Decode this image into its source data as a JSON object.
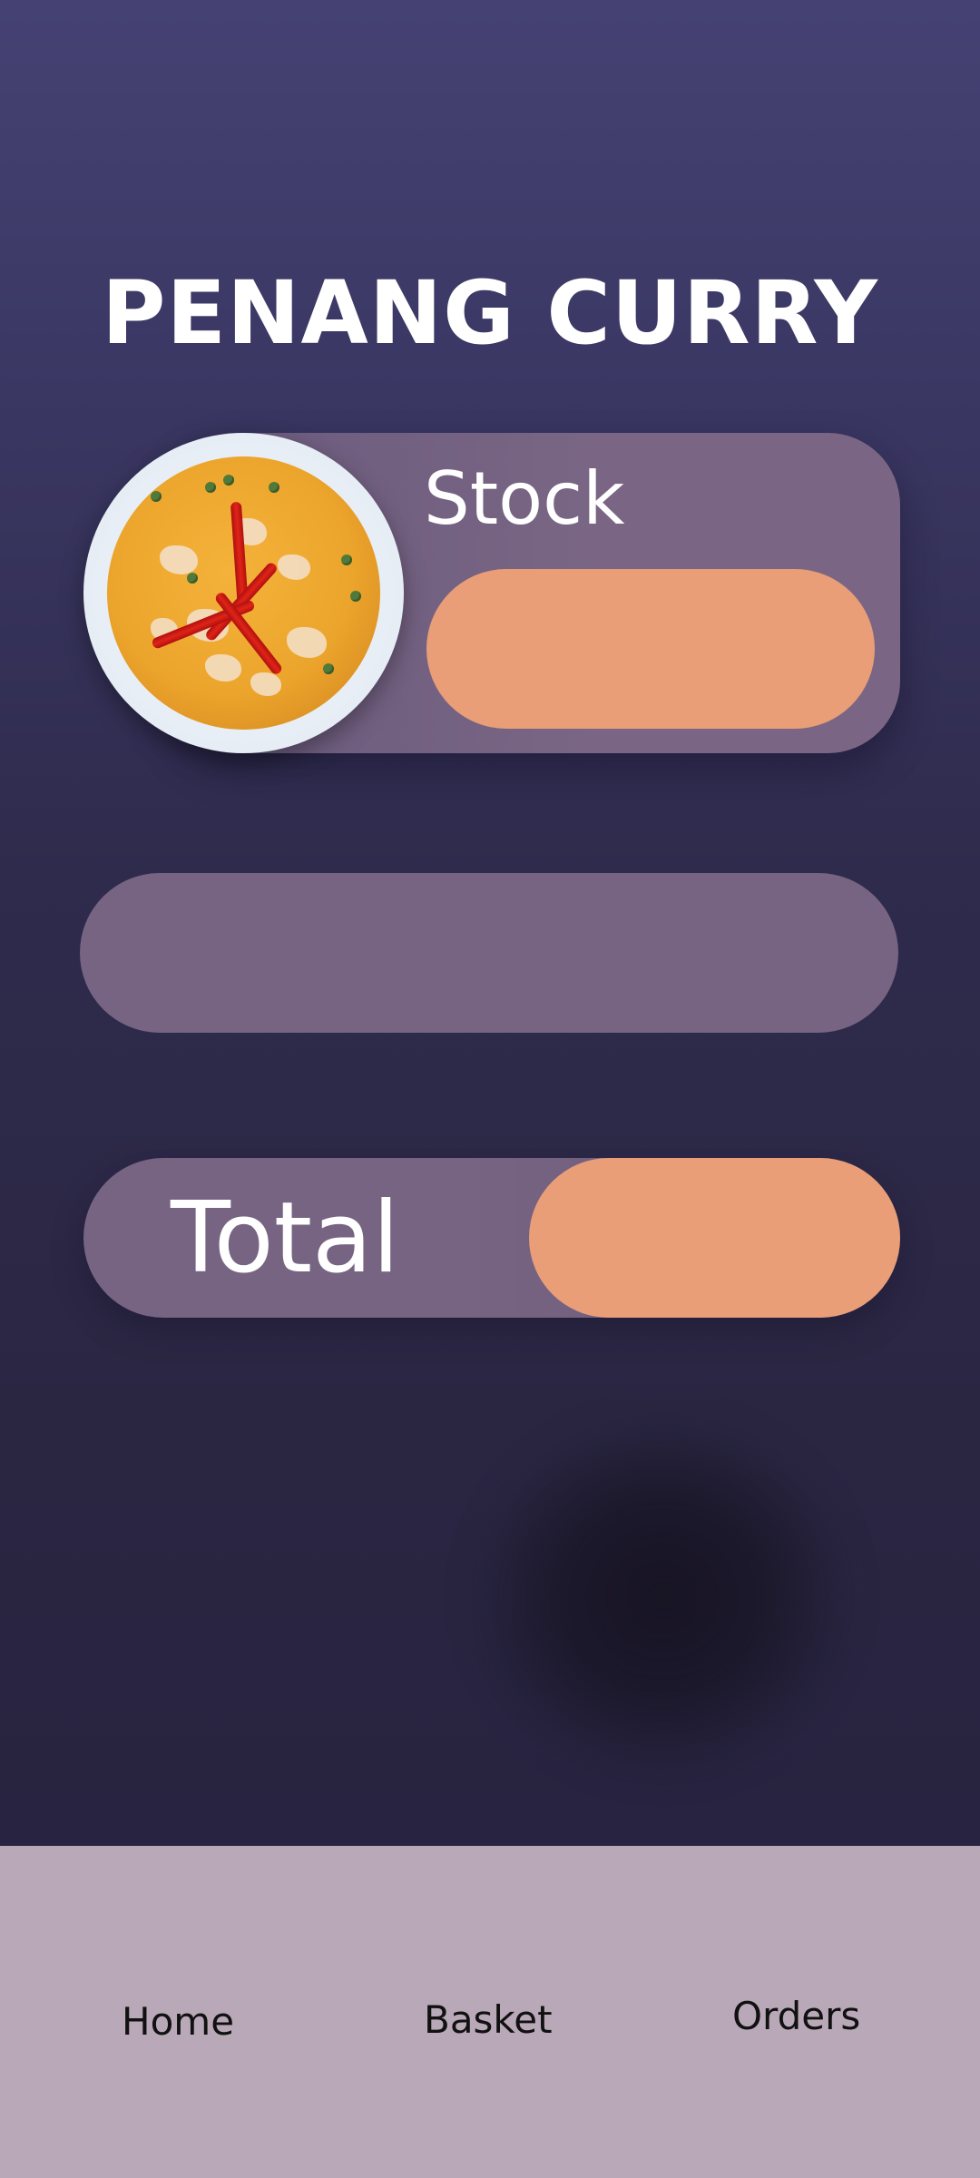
{
  "page": {
    "title": "PENANG CURRY"
  },
  "item": {
    "image_icon": "curry-bowl-image",
    "stock_label": "Stock",
    "stock_value": ""
  },
  "field": {
    "value": ""
  },
  "total": {
    "label": "Total",
    "value": ""
  },
  "nav": {
    "items": [
      {
        "label": "Home"
      },
      {
        "label": "Basket"
      },
      {
        "label": "Orders"
      }
    ]
  },
  "colors": {
    "background_top": "#454273",
    "background_bottom": "#272340",
    "card": "#776482",
    "accent": "#e99e78",
    "nav_bar": "#b9a8b8",
    "text_light": "#ffffff",
    "text_dark": "#111111"
  }
}
